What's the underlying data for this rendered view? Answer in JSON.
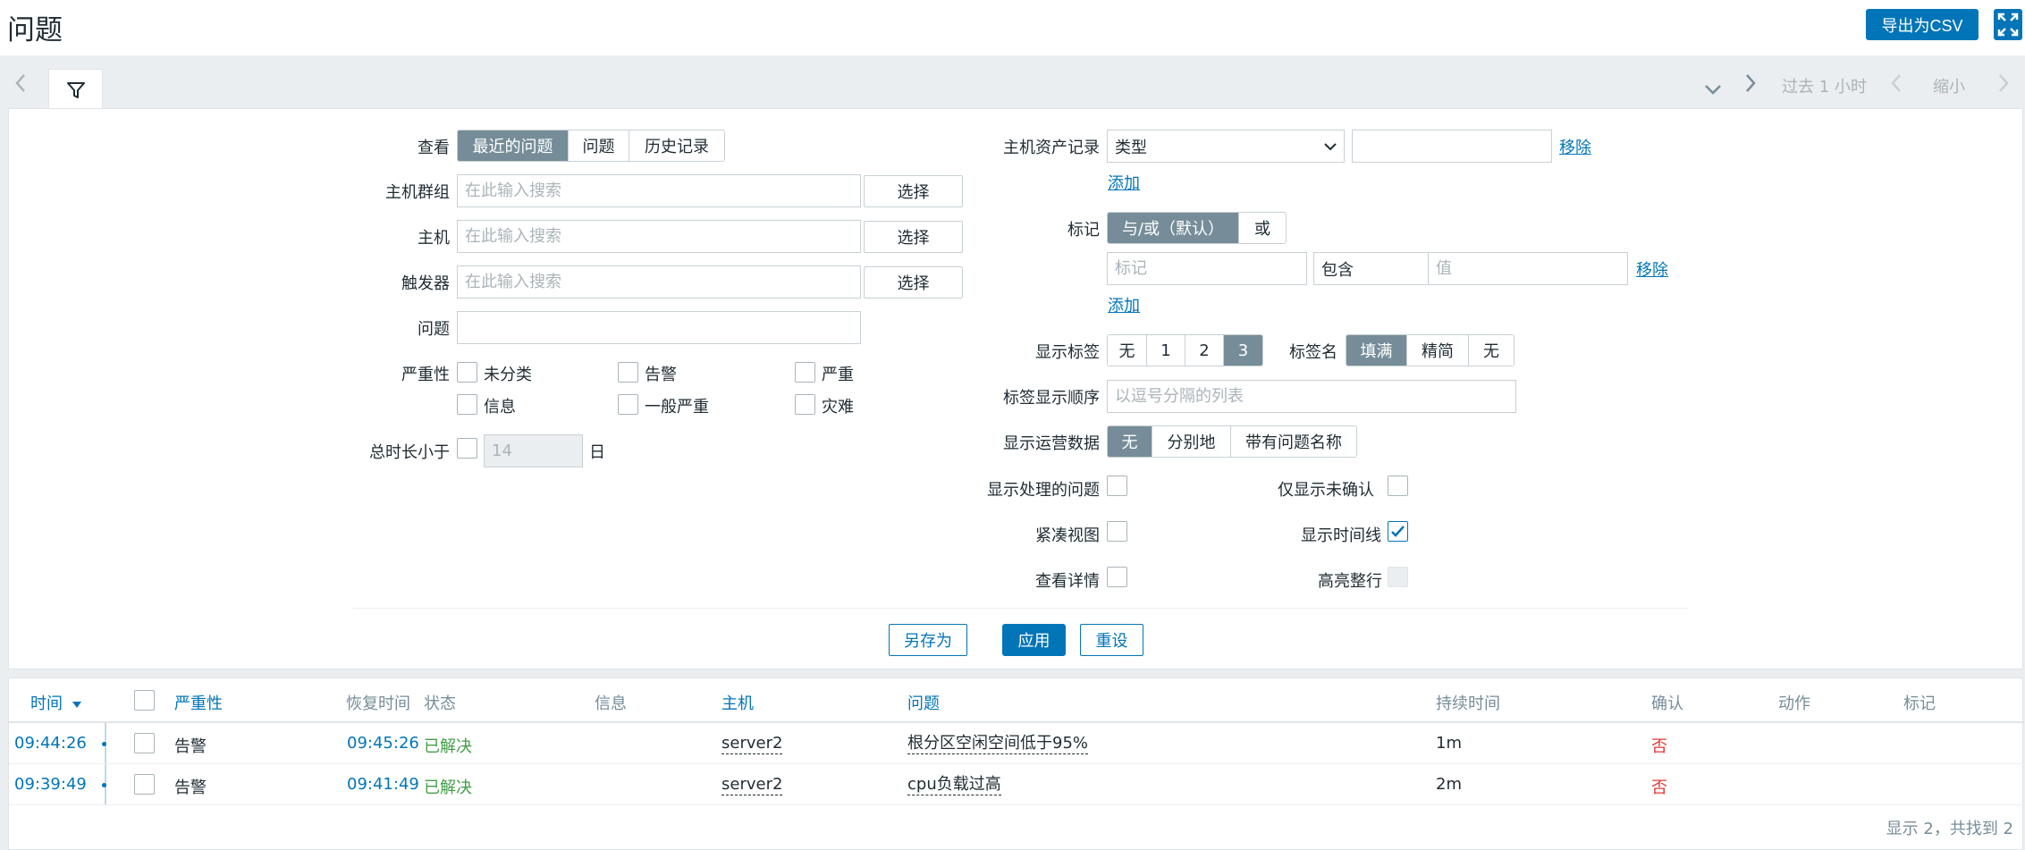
{
  "header": {
    "title": "问题",
    "export_label": "导出为CSV",
    "fullscreen_icon": "fullscreen-icon"
  },
  "tabbar": {
    "prev_icon": "chevron-left-icon",
    "filter_icon": "filter-icon",
    "collapse_icon": "chevron-down-icon",
    "next_icon": "chevron-right-icon",
    "time_range": "过去 1 小时",
    "zoom_label": "缩小"
  },
  "filter": {
    "view_label": "查看",
    "view_options": [
      "最近的问题",
      "问题",
      "历史记录"
    ],
    "hostgroup_label": "主机群组",
    "host_label": "主机",
    "trigger_label": "触发器",
    "search_placeholder": "在此输入搜索",
    "select_label": "选择",
    "problem_label": "问题",
    "severity_label": "严重性",
    "severities": [
      "未分类",
      "告警",
      "严重",
      "信息",
      "一般严重",
      "灾难"
    ],
    "age_label": "总时长小于",
    "age_value": "14",
    "age_unit": "日",
    "inventory_label": "主机资产记录",
    "inventory_field": "类型",
    "remove_label": "移除",
    "add_label": "添加",
    "tags_label": "标记",
    "tags_options": [
      "与/或（默认）",
      "或"
    ],
    "tag_placeholder": "标记",
    "tag_operator": "包含",
    "value_placeholder": "值",
    "show_tags_label": "显示标签",
    "show_tags_options": [
      "无",
      "1",
      "2",
      "3"
    ],
    "tag_name_label": "标签名",
    "tag_name_options": [
      "填满",
      "精简",
      "无"
    ],
    "tag_priority_label": "标签显示顺序",
    "tag_priority_placeholder": "以逗号分隔的列表",
    "opdata_label": "显示运营数据",
    "opdata_options": [
      "无",
      "分别地",
      "带有问题名称"
    ],
    "show_suppressed_label": "显示处理的问题",
    "unack_only_label": "仅显示未确认",
    "compact_label": "紧凑视图",
    "timeline_label": "显示时间线",
    "details_label": "查看详情",
    "highlight_label": "高亮整行",
    "save_as_label": "另存为",
    "apply_label": "应用",
    "reset_label": "重设"
  },
  "table": {
    "columns": {
      "time": "时间",
      "severity": "严重性",
      "recovery": "恢复时间",
      "status": "状态",
      "info": "信息",
      "host": "主机",
      "problem": "问题",
      "duration": "持续时间",
      "ack": "确认",
      "actions": "动作",
      "tags": "标记"
    },
    "rows": [
      {
        "time": "09:44:26",
        "severity": "告警",
        "recovery": "09:45:26",
        "status": "已解决",
        "host": "server2",
        "problem": "根分区空闲空间低于95%",
        "duration": "1m",
        "ack": "否"
      },
      {
        "time": "09:39:49",
        "severity": "告警",
        "recovery": "09:41:49",
        "status": "已解决",
        "host": "server2",
        "problem": "cpu负载过高",
        "duration": "2m",
        "ack": "否"
      }
    ],
    "footer": "显示 2，共找到 2"
  }
}
